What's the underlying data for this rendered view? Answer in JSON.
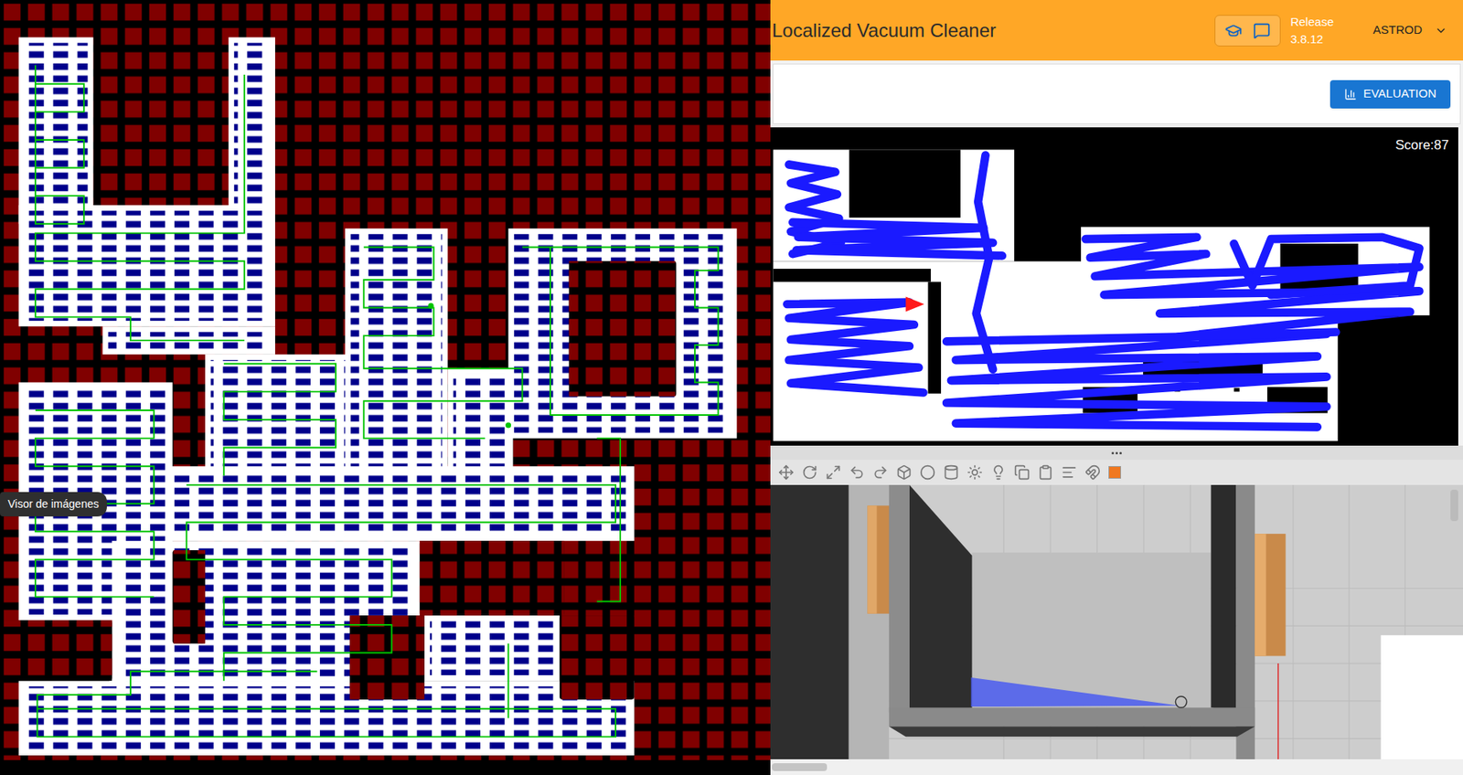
{
  "image_viewer": {
    "tooltip": "Visor de imágenes"
  },
  "app": {
    "title": "Localized Vacuum Cleaner",
    "release_label": "Release",
    "release_version": "3.8.12",
    "user": "ASTROD",
    "evaluation_button": "EVALUATION"
  },
  "map": {
    "score": "Score:87"
  }
}
